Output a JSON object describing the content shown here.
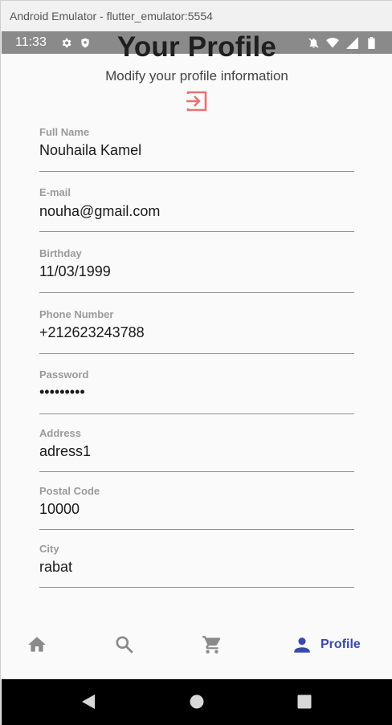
{
  "window": {
    "title": "Android Emulator - flutter_emulator:5554"
  },
  "status_bar": {
    "time": "11:33"
  },
  "page": {
    "title": "Your Profile",
    "subtitle": "Modify your profile information"
  },
  "fields": [
    {
      "label": "Full Name",
      "value": "Nouhaila Kamel"
    },
    {
      "label": "E-mail",
      "value": "nouha@gmail.com"
    },
    {
      "label": "Birthday",
      "value": "11/03/1999"
    },
    {
      "label": "Phone Number",
      "value": "+212623243788"
    },
    {
      "label": "Password",
      "value": "•••••••••"
    },
    {
      "label": "Address",
      "value": "adress1"
    },
    {
      "label": "Postal Code",
      "value": "10000"
    },
    {
      "label": "City",
      "value": "rabat"
    }
  ],
  "bottom_nav": {
    "items": [
      {
        "icon": "home-icon"
      },
      {
        "icon": "search-icon"
      },
      {
        "icon": "cart-icon"
      },
      {
        "icon": "person-icon",
        "label": "Profile"
      }
    ],
    "active_color": "#3949ab",
    "inactive_color": "#8a8a8a"
  },
  "colors": {
    "logout_icon": "#e57373"
  }
}
